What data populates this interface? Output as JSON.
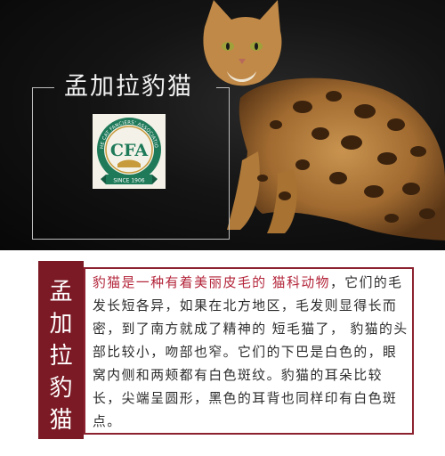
{
  "hero": {
    "title": "孟加拉豹猫",
    "logo": {
      "name": "cfa-logo-icon",
      "text": "THE CAT FANCIERS' ASSOCIATION",
      "monogram": "CFA",
      "since": "SINCE 1906"
    },
    "background": "#0b0b0b"
  },
  "info": {
    "side_label": [
      "孟",
      "加",
      "拉",
      "豹",
      "猫"
    ],
    "highlight": "豹猫是一种有着美丽皮毛的 猫科动物",
    "body": "，它们的毛发长短各异，如果在北方地区，毛发则显得长而密，到了南方就成了精神的 短毛猫了， 豹猫的头部比较小，吻部也窄。它们的下巴是白色的，眼窝内侧和两颊都有白色斑纹。豹猫的耳朵比较长，尖端呈圆形，黑色的耳背也同样印有白色斑点。",
    "colors": {
      "accent": "#7b1a24",
      "highlight_text": "#b3253a"
    }
  }
}
